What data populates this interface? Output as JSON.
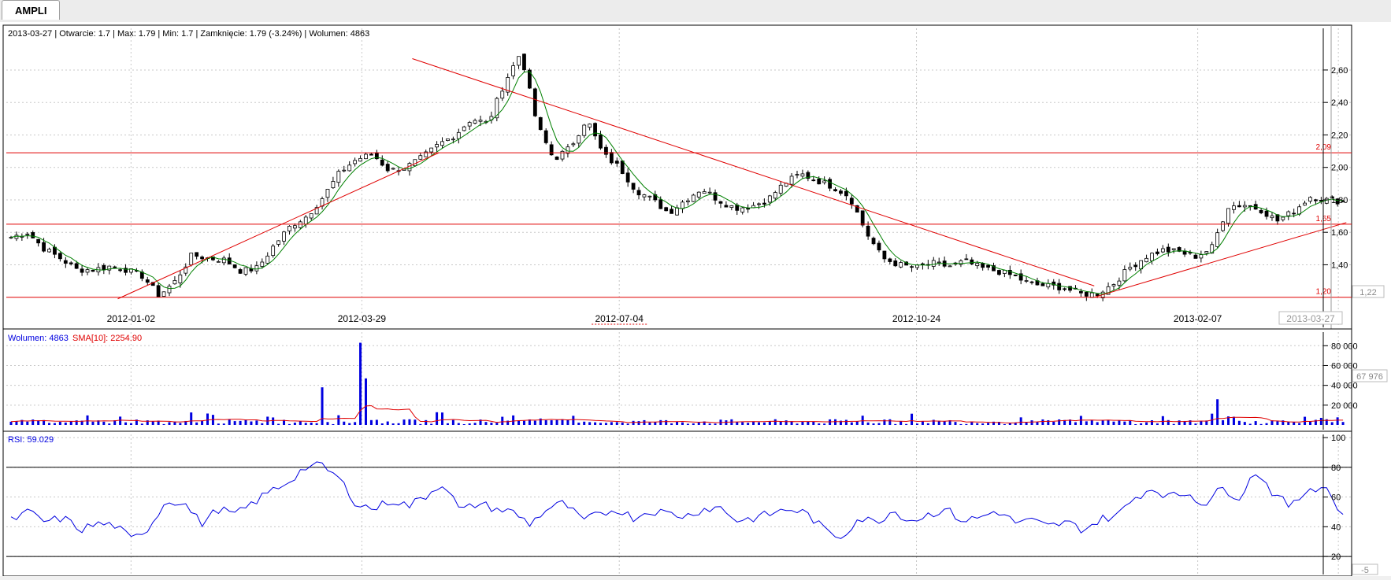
{
  "tab": {
    "label": "AMPLI"
  },
  "price_info": "2013-03-27 | Otwarcie: 1.7 | Max: 1.79 | Min: 1.7 | Zamknięcie: 1.79 (-3.24%)  | Wolumen: 4863",
  "colors": {
    "grid": "#c8c8c8",
    "line": "#e00000",
    "sma": "#008000",
    "volume": "#0000e0",
    "rsi": "#0000e0",
    "axis": "#000000"
  },
  "chart_data": [
    {
      "type": "candlestick",
      "title": "AMPLI",
      "ylim": [
        1.15,
        2.75
      ],
      "y_ticks": [
        "2,60",
        "2,40",
        "2,20",
        "2,00",
        "1,80",
        "1,60",
        "1,40"
      ],
      "x_ticks": [
        "2012-01-02",
        "2012-03-29",
        "2012-07-04",
        "2012-10-24",
        "2013-02-07"
      ],
      "cursor_date_label": "2013-03-27",
      "last_price_label": "1,22",
      "horizontal_lines": [
        {
          "value": 2.09,
          "label": "2,09"
        },
        {
          "value": 1.65,
          "label": "1,65"
        },
        {
          "value": 1.2,
          "label": "1,20"
        }
      ],
      "trend_lines": [
        {
          "from": [
            "2011-12-28",
            1.19
          ],
          "to": [
            "2012-04-27",
            2.09
          ]
        },
        {
          "from": [
            "2012-04-17",
            2.67
          ],
          "to": [
            "2012-12-30",
            1.27
          ]
        },
        {
          "from": [
            "2012-12-30",
            1.2
          ],
          "to": [
            "2013-04-04",
            1.66
          ]
        }
      ],
      "close_series": [
        1.57,
        1.6,
        1.5,
        1.44,
        1.37,
        1.37,
        1.39,
        1.37,
        1.33,
        1.21,
        1.3,
        1.46,
        1.44,
        1.43,
        1.36,
        1.38,
        1.52,
        1.64,
        1.7,
        1.82,
        1.97,
        2.05,
        2.08,
        1.98,
        2.0,
        2.06,
        2.14,
        2.2,
        2.3,
        2.27,
        2.52,
        2.71,
        2.26,
        2.05,
        2.12,
        2.3,
        2.08,
        2.0,
        1.86,
        1.8,
        1.72,
        1.8,
        1.87,
        1.8,
        1.75,
        1.76,
        1.8,
        1.9,
        1.96,
        1.92,
        1.88,
        1.82,
        1.6,
        1.44,
        1.4,
        1.38,
        1.41,
        1.39,
        1.42,
        1.38,
        1.36,
        1.33,
        1.28,
        1.27,
        1.26,
        1.22,
        1.22,
        1.28,
        1.38,
        1.45,
        1.49,
        1.48,
        1.45,
        1.5,
        1.76,
        1.77,
        1.74,
        1.67,
        1.73,
        1.82,
        1.8,
        1.79
      ],
      "sma_label": "SMA"
    },
    {
      "type": "bar",
      "title": "Wolumen: 4863",
      "series_label": "Wolumen: 4863",
      "sma_label": "SMA[10]: 2254.90",
      "ylim": [
        0,
        85000
      ],
      "y_ticks": [
        "80 000",
        "60 000",
        "40 000",
        "20 000"
      ],
      "cursor_value_label": "67 976",
      "peaks": [
        {
          "date": "2012-03-29",
          "value": 83000
        },
        {
          "date": "2012-03-31",
          "value": 47000
        },
        {
          "date": "2012-03-15",
          "value": 38000
        },
        {
          "date": "2013-02-15",
          "value": 26000
        }
      ]
    },
    {
      "type": "line",
      "title": "RSI: 59.029",
      "ylim": [
        10,
        100
      ],
      "y_ticks": [
        "100",
        "80",
        "60",
        "40",
        "20"
      ],
      "reference_lines": [
        80,
        20
      ],
      "cursor_value_label": "-5",
      "values": [
        44,
        50,
        43,
        46,
        38,
        42,
        41,
        31,
        40,
        58,
        56,
        42,
        52,
        48,
        56,
        64,
        70,
        80,
        81,
        72,
        55,
        52,
        58,
        54,
        61,
        70,
        50,
        56,
        52,
        50,
        42,
        52,
        56,
        44,
        48,
        52,
        46,
        51,
        49,
        47,
        52,
        53,
        44,
        46,
        49,
        52,
        49,
        38,
        33,
        46,
        43,
        51,
        44,
        48,
        52,
        44,
        46,
        51,
        43,
        44,
        40,
        43,
        38,
        45,
        48,
        60,
        66,
        60,
        63,
        55,
        66,
        60,
        78,
        62,
        53,
        66,
        67,
        47
      ]
    }
  ]
}
